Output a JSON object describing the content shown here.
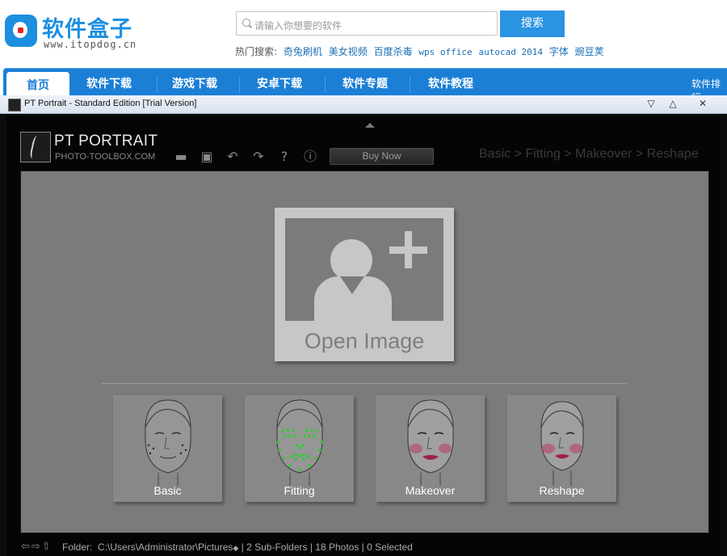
{
  "site": {
    "name": "软件盒子",
    "domain": "www.itopdog.cn",
    "search_placeholder": "请输入你想要的软件",
    "search_button": "搜索",
    "hot_label": "热门搜索:",
    "hot_keywords": [
      "奇兔刷机",
      "美女视频",
      "百度杀毒",
      "wps office",
      "autocad 2014",
      "字体",
      "豌豆荚"
    ],
    "nav": [
      "首页",
      "软件下载",
      "游戏下载",
      "安卓下载",
      "软件专题",
      "软件教程"
    ],
    "nav_right": "软件排行"
  },
  "window": {
    "title": "PT Portrait - Standard Edition [Trial Version]",
    "buttons": [
      "▽",
      "△",
      "✕"
    ]
  },
  "app": {
    "brand_name": "PT PORTRAIT",
    "brand_url": "PHOTO-TOOLBOX.COM",
    "toolbar_icons": [
      "folder-icon",
      "save-icon",
      "undo-icon",
      "redo-icon",
      "help-icon",
      "info-icon"
    ],
    "toolbar_glyphs": [
      "▬",
      "▣",
      "↶",
      "↷",
      "?",
      "ⓘ"
    ],
    "buy_now": "Buy Now",
    "breadcrumb": "Basic > Fitting > Makeover > Reshape",
    "open_image": "Open Image",
    "modes": [
      "Basic",
      "Fitting",
      "Makeover",
      "Reshape"
    ],
    "status": {
      "nav_glyphs": "⇦⇨⇧",
      "folder_label": "Folder:",
      "path": "C:\\Users\\Administrator\\Pictures",
      "sort": "◆",
      "subfolders": "2 Sub-Folders",
      "photos": "18 Photos",
      "selected": "0 Selected"
    }
  },
  "colors": {
    "site_blue": "#1b7fd6",
    "workspace_gray": "#7b7b7b",
    "fitting_points": "#2ecc2e",
    "makeover_blush": "#b3556e"
  }
}
